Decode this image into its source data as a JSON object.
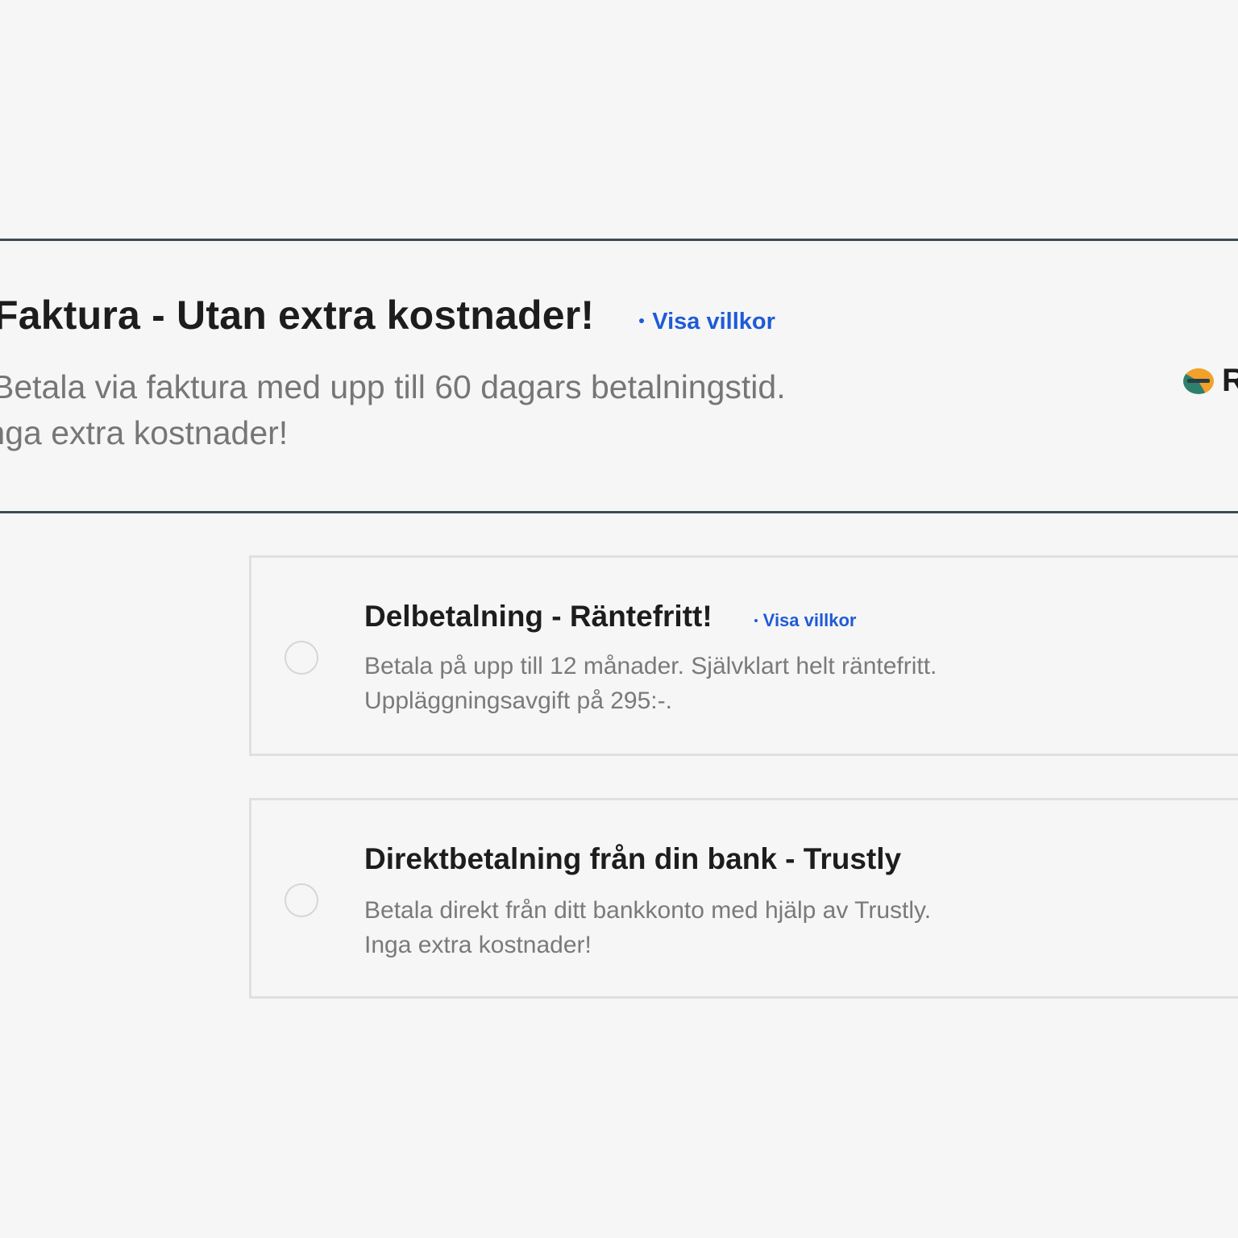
{
  "payment_options": {
    "invoice": {
      "title": "Faktura - Utan extra kostnader!",
      "terms_link": "Visa villkor",
      "description_line1": "Betala via faktura med upp till 60 dagars betalningstid.",
      "description_line2": "Inga extra kostnader!",
      "brand_letter": "R",
      "selected": true
    },
    "installment": {
      "title": "Delbetalning - Räntefritt!",
      "terms_link": "Visa villkor",
      "description_line1": "Betala på upp till 12 månader. Självklart helt räntefritt.",
      "description_line2": "Uppläggningsavgift på 295:-.",
      "selected": false
    },
    "direct_bank": {
      "title": "Direktbetalning från din bank - Trustly",
      "description_line1": "Betala direkt från ditt bankkonto med hjälp av Trustly.",
      "description_line2": "Inga extra kostnader!",
      "selected": false
    }
  },
  "colors": {
    "background": "#f6f6f6",
    "selected_border": "#3f4b53",
    "unselected_border": "#e0e0e0",
    "link": "#1f5bd6",
    "title_text": "#1d1d1d",
    "description_text": "#767676"
  },
  "icons": {
    "bullet": "dot-icon",
    "brand": "payment-provider-logo",
    "radio": "radio-button"
  }
}
